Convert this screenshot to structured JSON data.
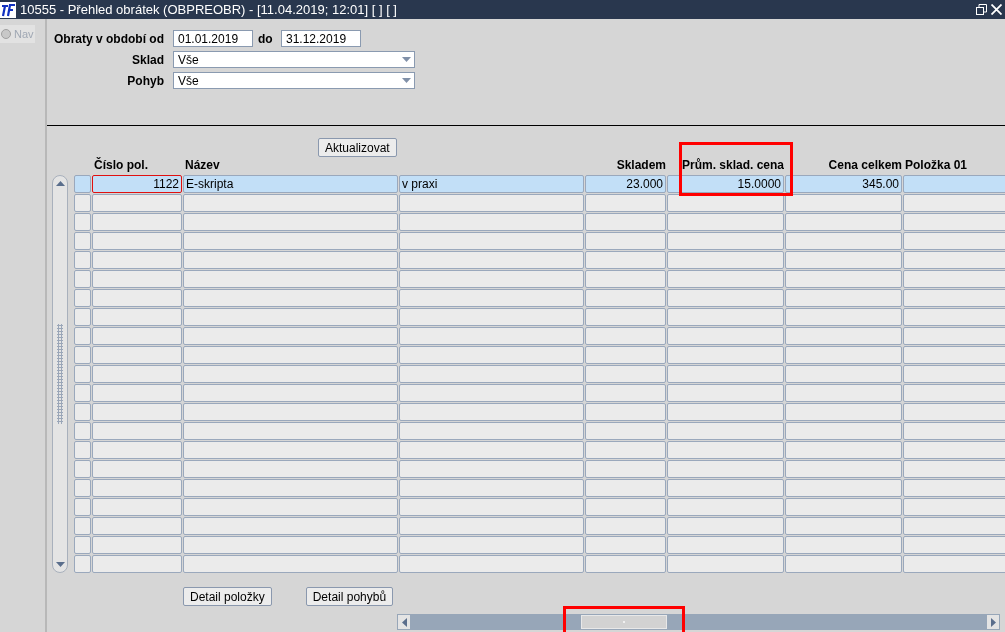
{
  "window": {
    "title": "10555 - Přehled obrátek (OBPREOBR) - [11.04.2019; 12:01]  [ ]  [ ]"
  },
  "nav": {
    "label": "Nav",
    "selected": false
  },
  "filters": {
    "period_label": "Obraty v období od",
    "from": "01.01.2019",
    "to_label": "do",
    "to": "31.12.2019",
    "selects": [
      {
        "label": "Sklad",
        "value": "Vše"
      },
      {
        "label": "Pohyb",
        "value": "Vše"
      }
    ]
  },
  "refresh_button": "Aktualizovat",
  "table": {
    "columns": [
      {
        "label": "Číslo pol.",
        "kind": "id"
      },
      {
        "label": "Název",
        "kind": "text"
      },
      {
        "kind": "text"
      },
      {
        "label": "Skladem",
        "kind": "number"
      },
      {
        "label": "Prům. sklad. cena",
        "kind": "number",
        "highlighted": true
      },
      {
        "label": "Cena celkem",
        "kind": "number"
      },
      {
        "label": "Položka 01",
        "kind": "text"
      }
    ],
    "rows": [
      {
        "selected": true,
        "cells": [
          {
            "text": "1122",
            "focused": true
          },
          {
            "text": "E-skripta",
            "focused": false
          },
          {
            "text": "v praxi",
            "focused": false
          },
          {
            "text": "23.000",
            "focused": false
          },
          {
            "text": "15.0000",
            "focused": false
          },
          {
            "text": "345.00",
            "focused": false
          }
        ]
      },
      {
        "selected": false
      },
      {
        "selected": false
      },
      {
        "selected": false
      },
      {
        "selected": false
      },
      {
        "selected": false
      },
      {
        "selected": false
      },
      {
        "selected": false
      },
      {
        "selected": false
      },
      {
        "selected": false
      },
      {
        "selected": false
      },
      {
        "selected": false
      },
      {
        "selected": false
      },
      {
        "selected": false
      },
      {
        "selected": false
      },
      {
        "selected": false
      },
      {
        "selected": false
      },
      {
        "selected": false
      },
      {
        "selected": false
      },
      {
        "selected": false
      },
      {
        "selected": false
      }
    ]
  },
  "buttons": [
    "Detail položky",
    "Detail pohybů"
  ],
  "horizontal_scrollbar": {
    "highlighted": true
  }
}
